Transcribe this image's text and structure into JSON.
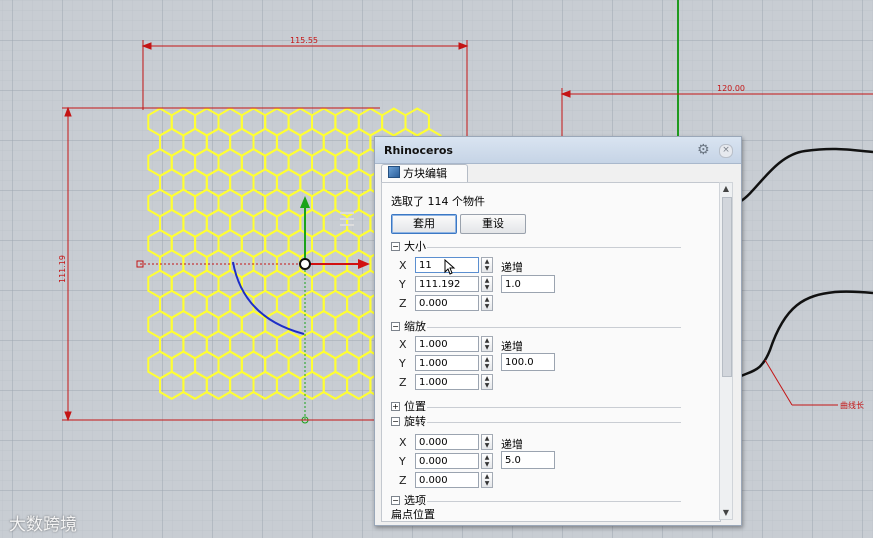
{
  "viewport": {
    "dimension_top": "115.55",
    "dimension_left": "111.19",
    "dimension_right": "120.00",
    "curve_label": "曲线长"
  },
  "panel": {
    "title": "Rhinoceros",
    "tab": "方块编辑",
    "selection_status": "选取了 114 个物件",
    "apply_button": "套用",
    "reset_button": "重设",
    "size": {
      "header": "大小",
      "x_label": "X",
      "x_value": "11",
      "y_label": "Y",
      "y_value": "111.192",
      "z_label": "Z",
      "z_value": "0.000",
      "increment_label": "递增",
      "increment_value": "1.0"
    },
    "scale": {
      "header": "缩放",
      "x_label": "X",
      "x_value": "1.000",
      "y_label": "Y",
      "y_value": "1.000",
      "z_label": "Z",
      "z_value": "1.000",
      "increment_label": "递增",
      "increment_value": "100.0"
    },
    "position": {
      "header": "位置"
    },
    "rotate": {
      "header": "旋转",
      "x_label": "X",
      "x_value": "0.000",
      "y_label": "Y",
      "y_value": "0.000",
      "z_label": "Z",
      "z_value": "0.000",
      "increment_label": "递增",
      "increment_value": "5.0"
    },
    "options": {
      "header": "选项",
      "base_point": "扁点位置"
    }
  },
  "watermark": "大数跨境",
  "colors": {
    "hex": "#ffff33",
    "dimension": "#c41515",
    "panel_title": "#c6d4e6",
    "viewport_bg": "#c8cdd3"
  }
}
